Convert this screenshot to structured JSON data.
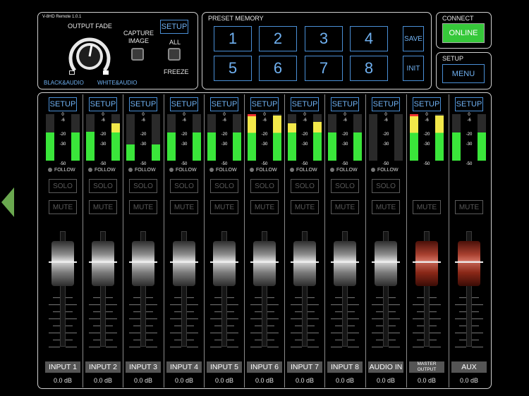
{
  "app": {
    "version": "V-8HD Remote 1.0.1"
  },
  "output_fade": {
    "title": "OUTPUT FADE",
    "left_label": "BLACK&AUDIO",
    "right_label": "WHITE&AUDIO"
  },
  "capture": {
    "label_line1": "CAPTURE",
    "label_line2": "IMAGE",
    "setup_label": "SETUP",
    "all_label": "ALL",
    "freeze_label": "FREEZE"
  },
  "preset_memory": {
    "title": "PRESET MEMORY",
    "slots": [
      "1",
      "2",
      "3",
      "4",
      "5",
      "6",
      "7",
      "8"
    ],
    "save_label": "SAVE",
    "init_label": "INIT"
  },
  "connect": {
    "title": "CONNECT",
    "button_label": "ONLINE",
    "button_color": "#36c83a"
  },
  "setup_menu": {
    "title": "SETUP",
    "button_label": "MENU"
  },
  "meter_scale": [
    "0",
    "-6",
    "-20",
    "-30",
    "-50"
  ],
  "follow_label": "FOLLOW",
  "solo_label": "SOLO",
  "mute_label": "MUTE",
  "setup_label": "SETUP",
  "channels": [
    {
      "name": "INPUT 1",
      "value": "0.0 dB",
      "meter_l": 0.6,
      "meter_r": 0.6,
      "peak": false,
      "fader_color": "grey"
    },
    {
      "name": "INPUT 2",
      "value": "0.0 dB",
      "meter_l": 0.62,
      "meter_r": 0.8,
      "peak": false,
      "fader_color": "grey"
    },
    {
      "name": "INPUT 3",
      "value": "0.0 dB",
      "meter_l": 0.35,
      "meter_r": 0.35,
      "peak": false,
      "fader_color": "grey"
    },
    {
      "name": "INPUT 4",
      "value": "0.0 dB",
      "meter_l": 0.6,
      "meter_r": 0.6,
      "peak": false,
      "fader_color": "grey"
    },
    {
      "name": "INPUT 5",
      "value": "0.0 dB",
      "meter_l": 0.6,
      "meter_r": 0.6,
      "peak": false,
      "fader_color": "grey"
    },
    {
      "name": "INPUT 6",
      "value": "0.0 dB",
      "meter_l": 1.0,
      "meter_r": 0.97,
      "peak": true,
      "fader_color": "grey"
    },
    {
      "name": "INPUT 7",
      "value": "0.0 dB",
      "meter_l": 0.8,
      "meter_r": 0.83,
      "peak": false,
      "fader_color": "grey"
    },
    {
      "name": "INPUT 8",
      "value": "0.0 dB",
      "meter_l": 0.6,
      "meter_r": 0.6,
      "peak": false,
      "fader_color": "grey"
    },
    {
      "name": "AUDIO IN",
      "value": "0.0 dB",
      "meter_l": 0.0,
      "meter_r": 0.0,
      "peak": false,
      "fader_color": "grey"
    },
    {
      "name": "MASTER OUTPUT",
      "value": "0.0 dB",
      "meter_l": 1.0,
      "meter_r": 0.97,
      "peak": true,
      "fader_color": "red"
    },
    {
      "name": "AUX",
      "value": "0.0 dB",
      "meter_l": 0.6,
      "meter_r": 0.6,
      "peak": false,
      "fader_color": "red"
    }
  ]
}
